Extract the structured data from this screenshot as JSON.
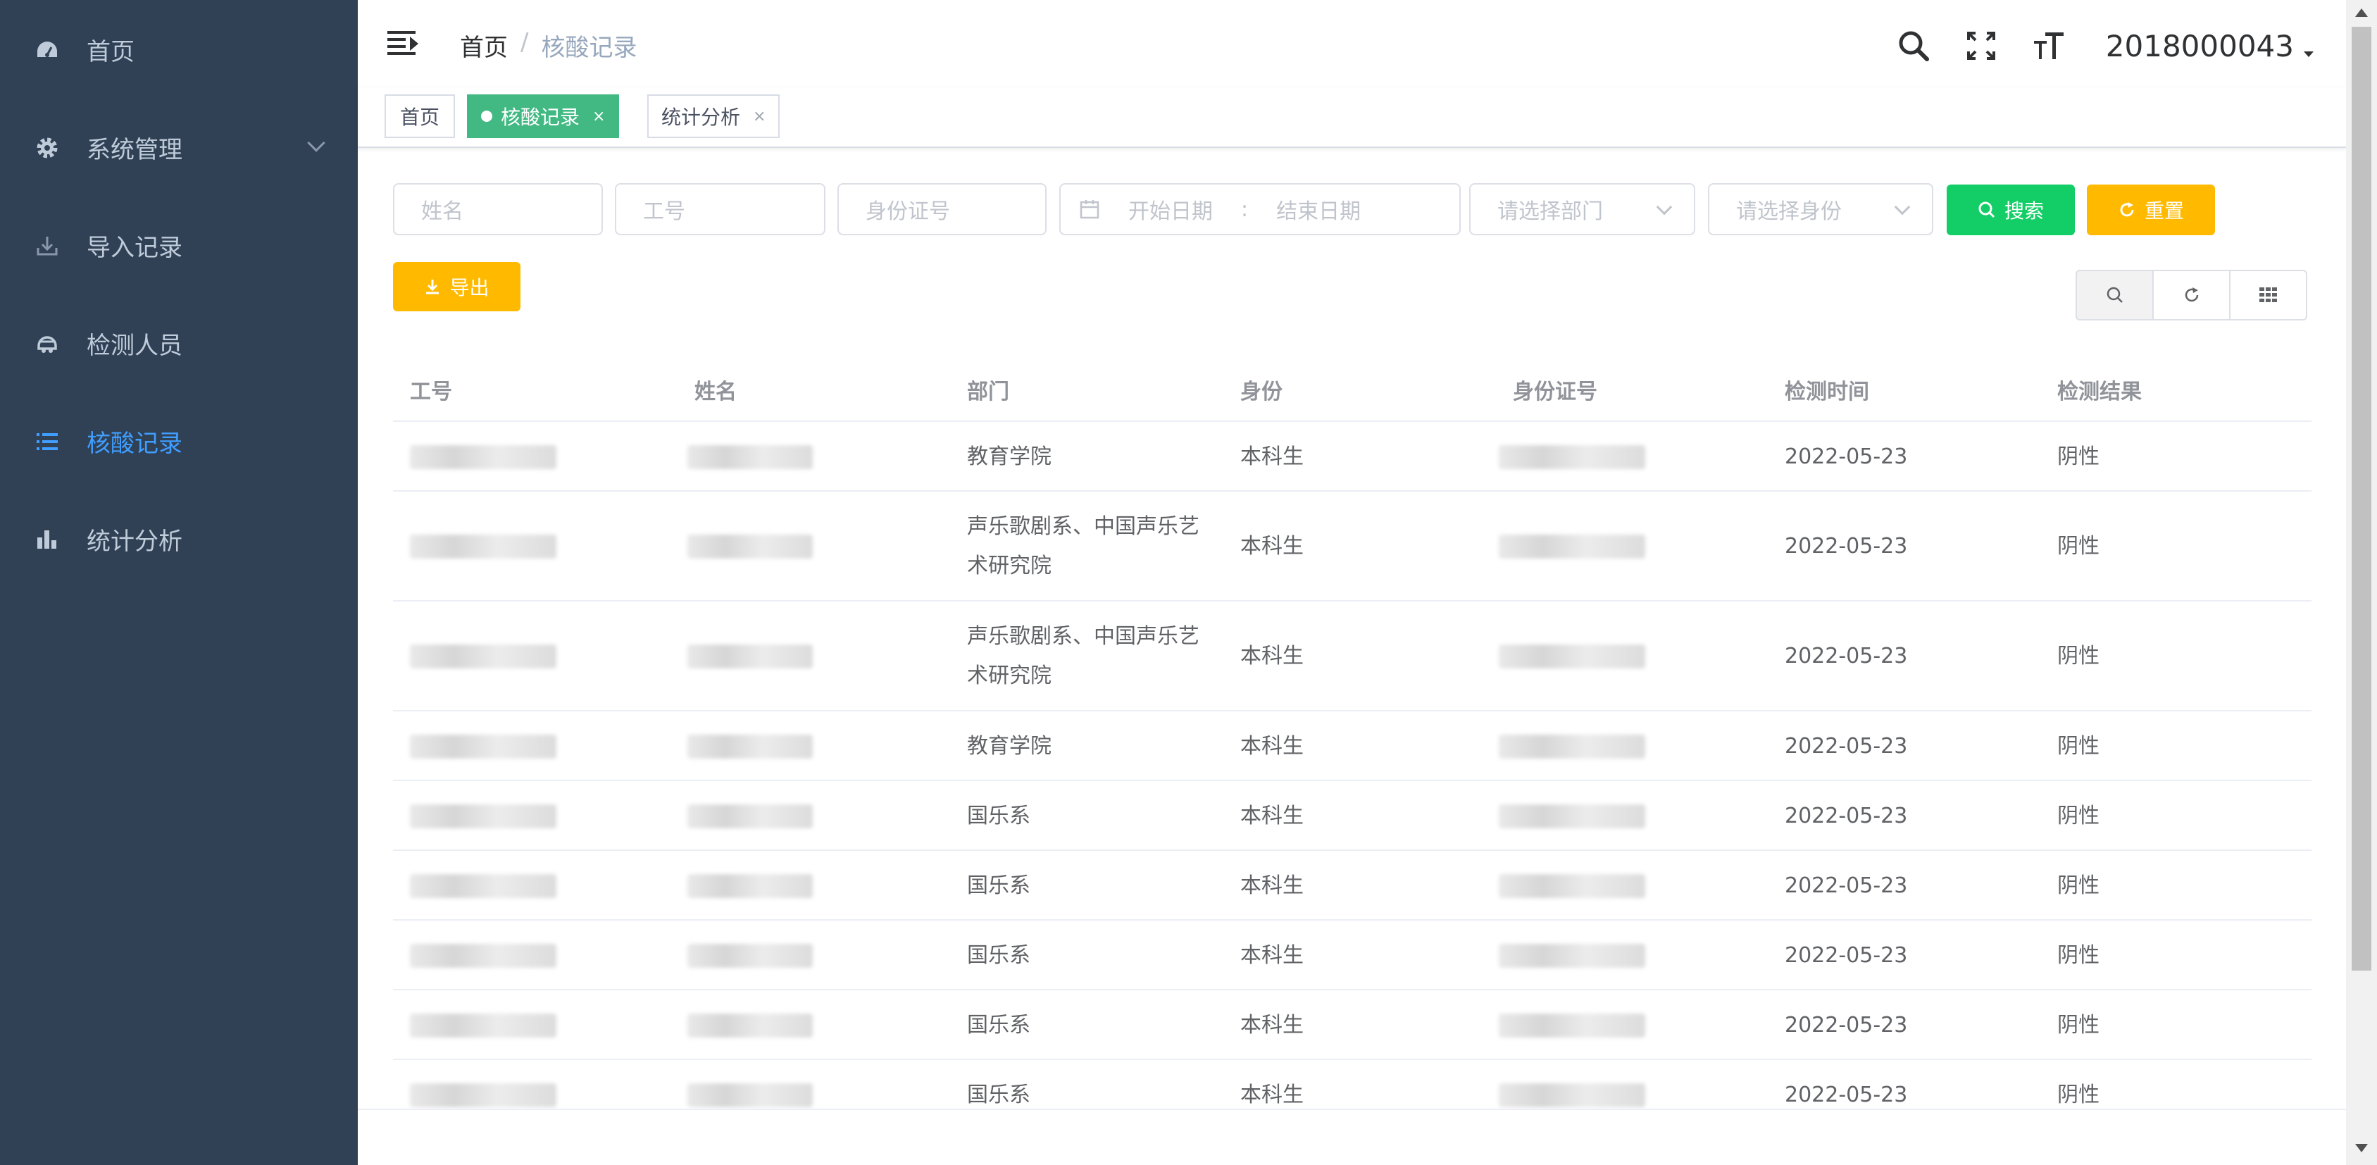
{
  "sidebar": {
    "items": [
      {
        "label": "首页",
        "icon": "dashboard-icon"
      },
      {
        "label": "系统管理",
        "icon": "gear-icon",
        "has_submenu": true
      },
      {
        "label": "导入记录",
        "icon": "download-icon"
      },
      {
        "label": "检测人员",
        "icon": "people-icon"
      },
      {
        "label": "核酸记录",
        "icon": "list-icon",
        "active": true
      },
      {
        "label": "统计分析",
        "icon": "bar-chart-icon"
      }
    ],
    "active_color": "#409eff",
    "background": "#304156"
  },
  "header": {
    "breadcrumb": {
      "home": "首页",
      "separator": "/",
      "current": "核酸记录"
    },
    "user_id": "2018000043"
  },
  "tags": [
    {
      "label": "首页",
      "active": false
    },
    {
      "label": "核酸记录",
      "active": true,
      "close": "×"
    },
    {
      "label": "统计分析",
      "active": false,
      "close": "×"
    }
  ],
  "search": {
    "name_placeholder": "姓名",
    "staff_no_placeholder": "工号",
    "id_no_placeholder": "身份证号",
    "start_date_placeholder": "开始日期",
    "date_separator": ":",
    "end_date_placeholder": "结束日期",
    "department_placeholder": "请选择部门",
    "identity_placeholder": "请选择身份",
    "search_label": "搜索",
    "reset_label": "重置",
    "export_label": "导出"
  },
  "table": {
    "headers": [
      "工号",
      "姓名",
      "部门",
      "身份",
      "身份证号",
      "检测时间",
      "检测结果"
    ],
    "rows": [
      {
        "department": "教育学院",
        "identity": "本科生",
        "time": "2022-05-23",
        "result": "阴性"
      },
      {
        "department": "声乐歌剧系、中国声乐艺术研究院",
        "identity": "本科生",
        "time": "2022-05-23",
        "result": "阴性"
      },
      {
        "department": "声乐歌剧系、中国声乐艺术研究院",
        "identity": "本科生",
        "time": "2022-05-23",
        "result": "阴性"
      },
      {
        "department": "教育学院",
        "identity": "本科生",
        "time": "2022-05-23",
        "result": "阴性"
      },
      {
        "department": "国乐系",
        "identity": "本科生",
        "time": "2022-05-23",
        "result": "阴性"
      },
      {
        "department": "国乐系",
        "identity": "本科生",
        "time": "2022-05-23",
        "result": "阴性"
      },
      {
        "department": "国乐系",
        "identity": "本科生",
        "time": "2022-05-23",
        "result": "阴性"
      },
      {
        "department": "国乐系",
        "identity": "本科生",
        "time": "2022-05-23",
        "result": "阴性"
      },
      {
        "department": "国乐系",
        "identity": "本科生",
        "time": "2022-05-23",
        "result": "阴性"
      }
    ]
  },
  "colors": {
    "success": "#13ce66",
    "warning": "#ffba00",
    "tag_active": "#42b983"
  }
}
